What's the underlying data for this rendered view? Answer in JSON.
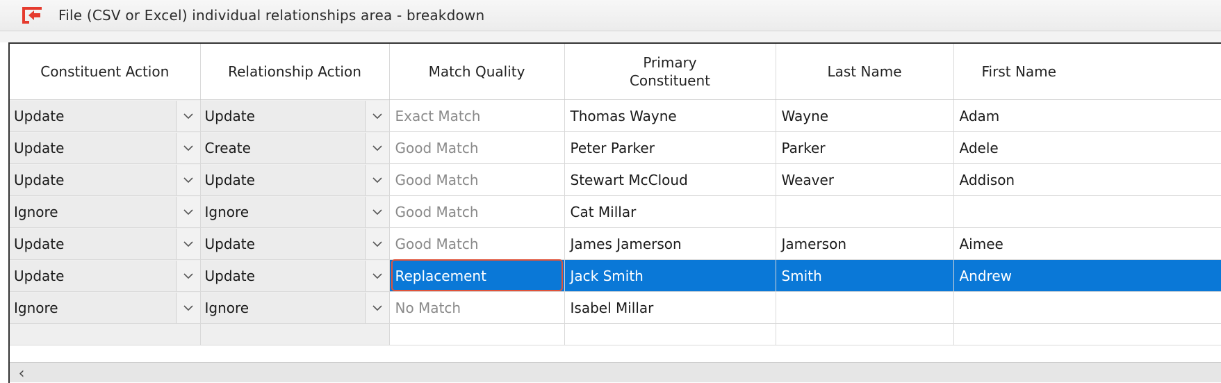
{
  "window": {
    "title": "File (CSV or Excel) individual relationships area - breakdown",
    "back_icon": "back-arrow-icon",
    "accent": "#e53b2e"
  },
  "grid": {
    "headers": [
      "Constituent Action",
      "Relationship Action",
      "Match Quality",
      "Primary Constituent",
      "Last Name",
      "First Name"
    ],
    "rows": [
      {
        "constituent_action": "Update",
        "relationship_action": "Update",
        "match_quality": "Exact Match",
        "primary_constituent": "Thomas Wayne",
        "last_name": "Wayne",
        "first_name": "Adam"
      },
      {
        "constituent_action": "Update",
        "relationship_action": "Create",
        "match_quality": "Good Match",
        "primary_constituent": "Peter Parker",
        "last_name": "Parker",
        "first_name": "Adele"
      },
      {
        "constituent_action": "Update",
        "relationship_action": "Update",
        "match_quality": "Good Match",
        "primary_constituent": "Stewart McCloud",
        "last_name": "Weaver",
        "first_name": "Addison"
      },
      {
        "constituent_action": "Ignore",
        "relationship_action": "Ignore",
        "match_quality": "Good Match",
        "primary_constituent": "Cat Millar",
        "last_name": "",
        "first_name": ""
      },
      {
        "constituent_action": "Update",
        "relationship_action": "Update",
        "match_quality": "Good Match",
        "primary_constituent": "James Jamerson",
        "last_name": "Jamerson",
        "first_name": "Aimee"
      },
      {
        "constituent_action": "Update",
        "relationship_action": "Update",
        "match_quality": "Replacement",
        "primary_constituent": "Jack Smith",
        "last_name": "Smith",
        "first_name": "Andrew"
      },
      {
        "constituent_action": "Ignore",
        "relationship_action": "Ignore",
        "match_quality": "No Match",
        "primary_constituent": "Isabel Millar",
        "last_name": "",
        "first_name": ""
      }
    ],
    "selected_row_index": 5,
    "selection_color": "#0a78d7"
  },
  "scrollbar": {
    "left_arrow": "‹"
  }
}
